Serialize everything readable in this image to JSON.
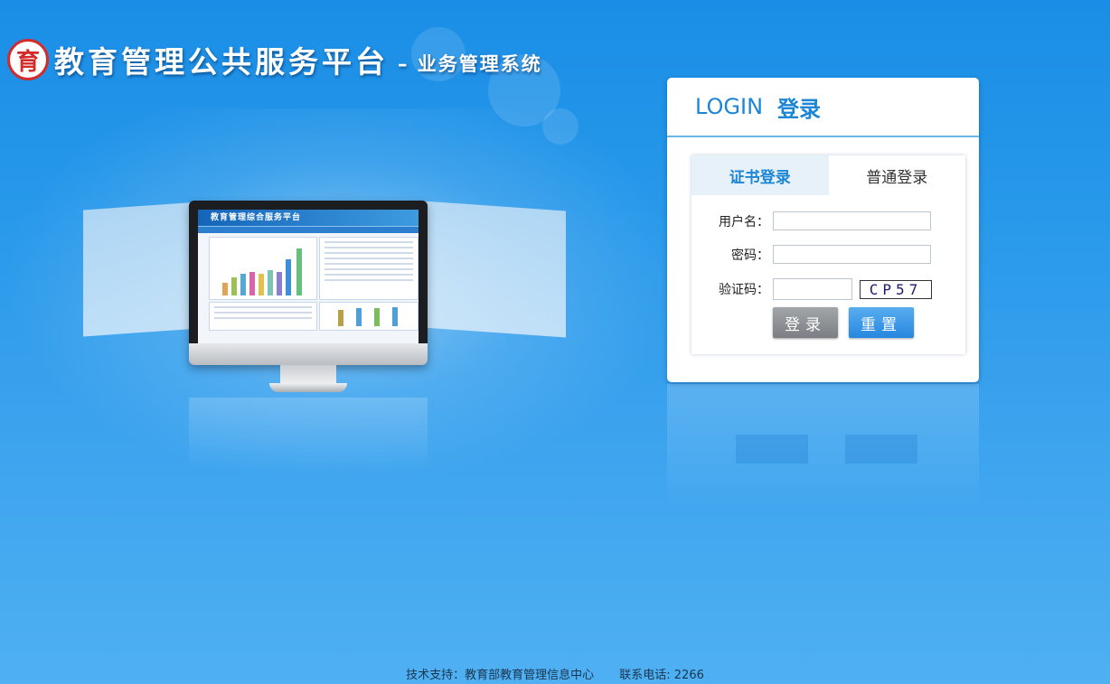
{
  "header": {
    "logo_glyph": "育",
    "title": "教育管理公共服务平台",
    "subtitle": "– 业务管理系统"
  },
  "showcase": {
    "screen_title": "教育管理综合服务平台"
  },
  "login": {
    "title_en": "LOGIN",
    "title_cn": "登录",
    "tabs": [
      {
        "label": "证书登录",
        "active": true
      },
      {
        "label": "普通登录",
        "active": false
      }
    ],
    "username_label": "用户名：",
    "username_value": "",
    "password_label": "密码：",
    "password_value": "",
    "captcha_label": "验证码：",
    "captcha_value": "",
    "captcha_code": "CP57",
    "login_button": "登录",
    "reset_button": "重置"
  },
  "footer": {
    "support": "技术支持：教育部教育管理信息中心",
    "phone": "联系电话: 2266"
  },
  "colors": {
    "accent": "#1d86d4",
    "login_btn": "#8a8d90",
    "reset_btn": "#3a9ae6",
    "logo_red": "#d32a2a"
  }
}
